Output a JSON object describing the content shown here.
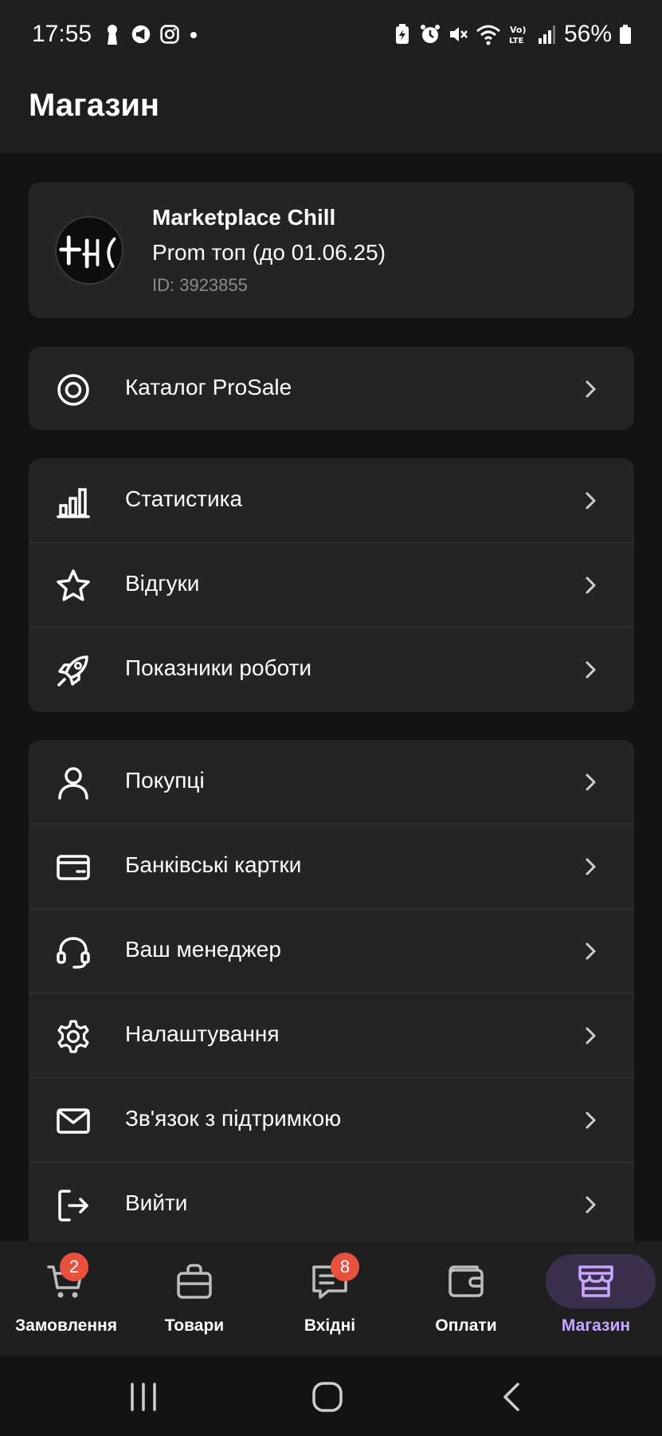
{
  "status_bar": {
    "time": "17:55",
    "battery_percent": "56%"
  },
  "header": {
    "title": "Магазин"
  },
  "shop": {
    "name": "Marketplace Chill",
    "plan": "Prom топ (до 01.06.25)",
    "id_text": "ID: 3923855",
    "avatar_icon": "shop-logo"
  },
  "menu_groups": [
    [
      {
        "label": "Каталог ProSale",
        "icon": "target-icon"
      }
    ],
    [
      {
        "label": "Статистика",
        "icon": "bar-chart-icon"
      },
      {
        "label": "Відгуки",
        "icon": "star-icon"
      },
      {
        "label": "Показники роботи",
        "icon": "rocket-icon"
      }
    ],
    [
      {
        "label": "Покупці",
        "icon": "user-icon"
      },
      {
        "label": "Банківські картки",
        "icon": "credit-card-icon"
      },
      {
        "label": "Ваш менеджер",
        "icon": "headset-icon"
      },
      {
        "label": "Налаштування",
        "icon": "gear-icon"
      },
      {
        "label": "Зв'язок з підтримкою",
        "icon": "mail-icon"
      },
      {
        "label": "Вийти",
        "icon": "logout-icon"
      }
    ]
  ],
  "bottom_nav": {
    "active": "Магазин",
    "accent_color": "#c9a7ff",
    "items": [
      {
        "label": "Замовлення",
        "icon": "cart-icon",
        "badge": "2"
      },
      {
        "label": "Товари",
        "icon": "bag-icon",
        "badge": ""
      },
      {
        "label": "Вхідні",
        "icon": "inbox-icon",
        "badge": "8"
      },
      {
        "label": "Оплати",
        "icon": "wallet-icon",
        "badge": ""
      },
      {
        "label": "Магазин",
        "icon": "store-icon",
        "badge": ""
      }
    ]
  },
  "colors": {
    "background": "#131313",
    "card": "#242424",
    "badge": "#e9513f",
    "muted_text": "#8b8b8b"
  }
}
